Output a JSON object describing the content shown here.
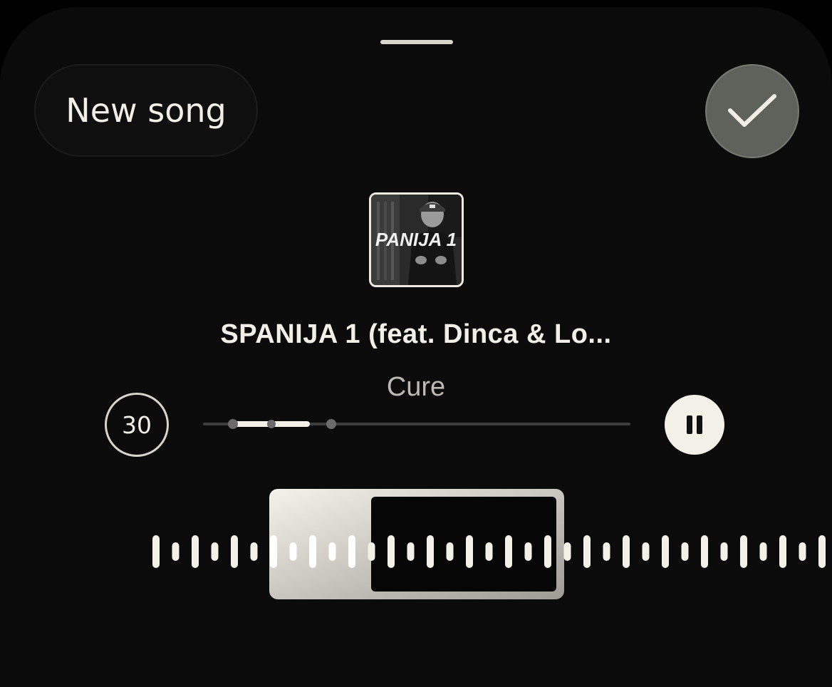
{
  "header": {
    "new_song_label": "New song",
    "confirm_icon": "checkmark-icon"
  },
  "track": {
    "cover_text": "PANIJA 1",
    "title": "SPANIJA 1 (feat. Dinca & Lo...",
    "artist": "Cure"
  },
  "player": {
    "duration_label": "30",
    "pause_icon": "pause-icon",
    "progress_fraction": 0.18,
    "clip_start_fraction": 0.07,
    "clip_end_fraction": 0.3
  },
  "waveform": {
    "selection_start_fraction": 0.24
  },
  "colors": {
    "background": "#0b0b0b",
    "text": "#f2efe6",
    "confirm_bg": "#5f615b",
    "bar": "#f3f0e7"
  }
}
